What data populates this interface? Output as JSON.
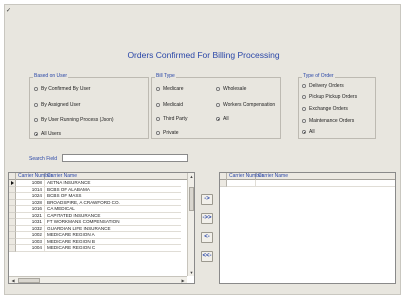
{
  "window": {
    "corner_mark": "✓"
  },
  "title": "Orders Confirmed For Billing Processing",
  "based_on_user": {
    "title": "Based on User",
    "options": [
      {
        "label": "By Confirmed By User",
        "selected": false
      },
      {
        "label": "By Assigned User",
        "selected": false
      },
      {
        "label": "By User Running Process (Json)",
        "selected": false
      },
      {
        "label": "All Users",
        "selected": true
      }
    ]
  },
  "bill_type": {
    "title": "Bill Type",
    "options": [
      {
        "label": "Medicare",
        "selected": false
      },
      {
        "label": "Wholesale",
        "selected": false
      },
      {
        "label": "Medicaid",
        "selected": false
      },
      {
        "label": "Workers Compensation",
        "selected": false
      },
      {
        "label": "Third Party",
        "selected": false
      },
      {
        "label": "All",
        "selected": true
      },
      {
        "label": "Private",
        "selected": false
      }
    ]
  },
  "type_of_order": {
    "title": "Type of Order",
    "options": [
      {
        "label": "Delivery Orders",
        "selected": false
      },
      {
        "label": "Pickup Pickup Orders",
        "selected": false
      },
      {
        "label": "Exchange Orders",
        "selected": false
      },
      {
        "label": "Maintenance Orders",
        "selected": false
      },
      {
        "label": "All",
        "selected": true
      }
    ]
  },
  "search": {
    "label": "Search Field",
    "value": ""
  },
  "left_grid": {
    "headers": [
      "Carrier Number",
      "Carrier Name"
    ],
    "rows": [
      [
        "1008",
        "AETNA INSURANCE"
      ],
      [
        "1014",
        "BCBS OF ALABAMA"
      ],
      [
        "1024",
        "BCBS OF MASS"
      ],
      [
        "1028",
        "BROADSPIRE, A CRAWFORD CO."
      ],
      [
        "1016",
        "CA MEDICAL"
      ],
      [
        "1021",
        "CAPITATED INSURANCE"
      ],
      [
        "1031",
        "FT WORKMANS COMPENSATION"
      ],
      [
        "1032",
        "GUARDIAN LIFE INSURANCE"
      ],
      [
        "1002",
        "MEDICARE REGION A"
      ],
      [
        "1003",
        "MEDICARE REGION B"
      ],
      [
        "1004",
        "MEDICARE REGION C"
      ]
    ]
  },
  "right_grid": {
    "headers": [
      "Carrier Number",
      "Carrier Name"
    ],
    "rows": []
  },
  "move_buttons": {
    "add_one": "->",
    "add_all": "->>",
    "remove_one": "<-",
    "remove_all": "<<-"
  },
  "colors": {
    "accent_text": "#2a47a8",
    "panel": "#e8e6df"
  }
}
